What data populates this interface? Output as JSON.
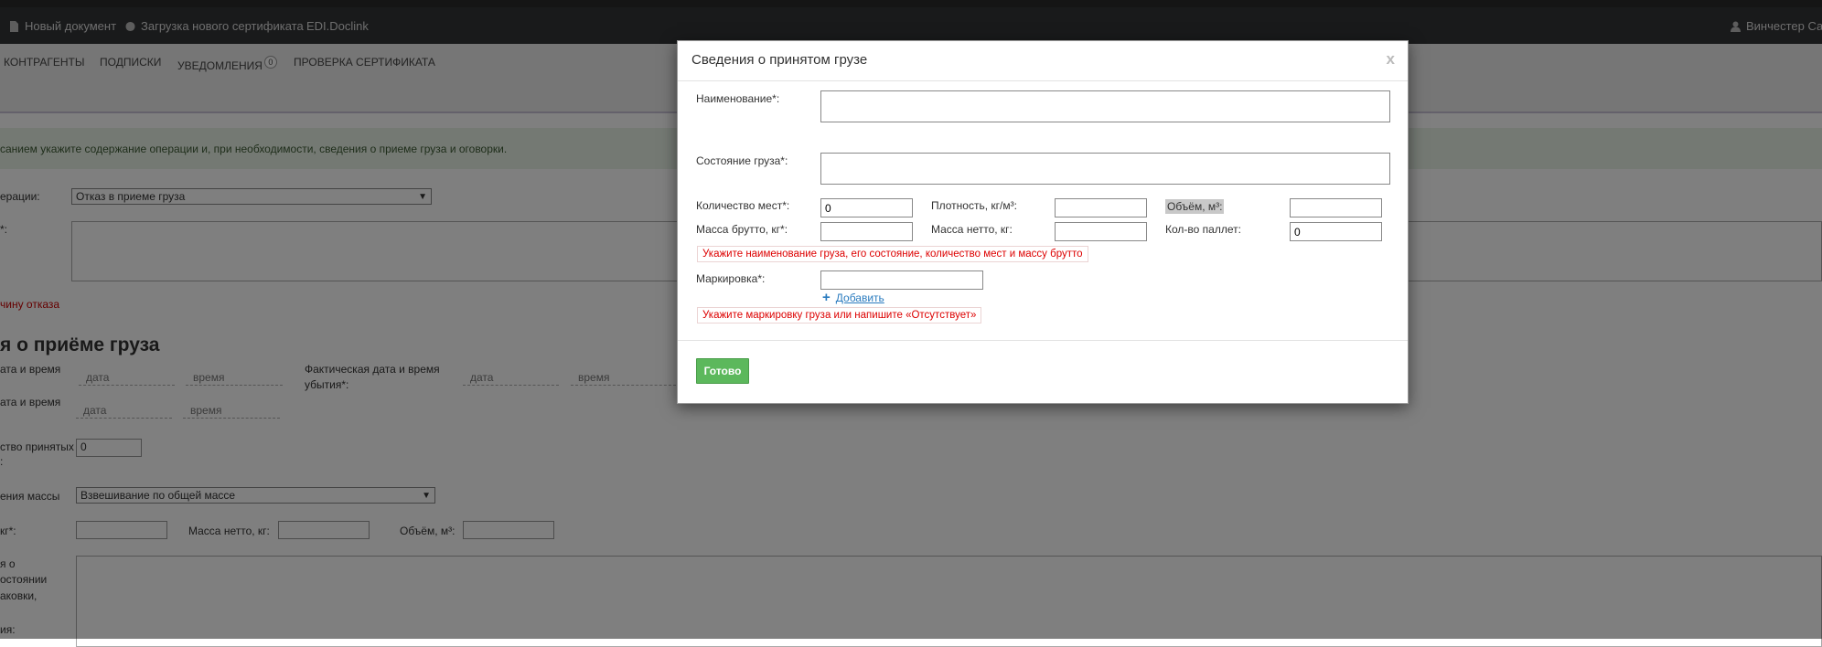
{
  "topbar": {
    "new_document": "Новый документ",
    "upload_certificate": "Загрузка нового сертификата",
    "edi_doclink": "EDI.Doclink",
    "user": "Винчестер Сам"
  },
  "subnav": {
    "counterparties": "КОНТРАГЕНТЫ",
    "subscriptions": "ПОДПИСКИ",
    "notifications": "УВЕДОМЛЕНИЯ",
    "notifications_count": "0",
    "certificate_check": "ПРОВЕРКА СЕРТИФИКАТА"
  },
  "background": {
    "info_text": "санием укажите содержание операции и, при необходимости, сведения о приеме груза и оговорки.",
    "operation_label": "ерации:",
    "operation_value": "Отказ в приеме груза",
    "comment_label": "*:",
    "refusal_reason_link": "чину отказа",
    "section_heading": "я о приёме груза",
    "arrival_label_1": "ата и время",
    "date_placeholder": "дата",
    "time_placeholder": "время",
    "actual_departure_label": "Фактическая дата и время убытия*:",
    "arrival_label_2": "ата и время",
    "accepted_count_label_1": "ство принятых",
    "accepted_count_label_2": ":",
    "accepted_count_value": "0",
    "mass_method_label": "ения массы",
    "mass_method_value": "Взвешивание по общей массе",
    "gross_label": "кг*:",
    "net_label": "Масса нетто, кг:",
    "volume_label": "Объём, м³:",
    "condition_label_1": "я о",
    "condition_label_2": "остоянии",
    "condition_label_3": "аковки,",
    "condition_label_4": "ия:"
  },
  "modal": {
    "title": "Сведения о принятом грузе",
    "close": "x",
    "name_label": "Наименование*:",
    "name_value": "",
    "condition_label": "Состояние груза*:",
    "condition_value": "",
    "places_label": "Количество мест*:",
    "places_value": "0",
    "density_label": "Плотность, кг/м³:",
    "density_value": "",
    "volume_label": "Объём, м³:",
    "volume_value": "",
    "gross_label": "Масса брутто, кг*:",
    "gross_value": "",
    "net_label": "Масса нетто, кг:",
    "net_value": "",
    "pallets_label": "Кол-во паллет:",
    "pallets_value": "0",
    "error_main": "Укажите наименование груза, его состояние, количество мест и массу брутто",
    "marking_label": "Маркировка*:",
    "marking_value": "",
    "add_link": "Добавить",
    "error_marking": "Укажите маркировку груза или напишите «Отсутствует»",
    "done_button": "Готово"
  },
  "colors": {
    "topbar_bg": "#333437",
    "done_button": "#5cb85c",
    "error_text": "#dd0000",
    "link": "#2a7bbf"
  }
}
